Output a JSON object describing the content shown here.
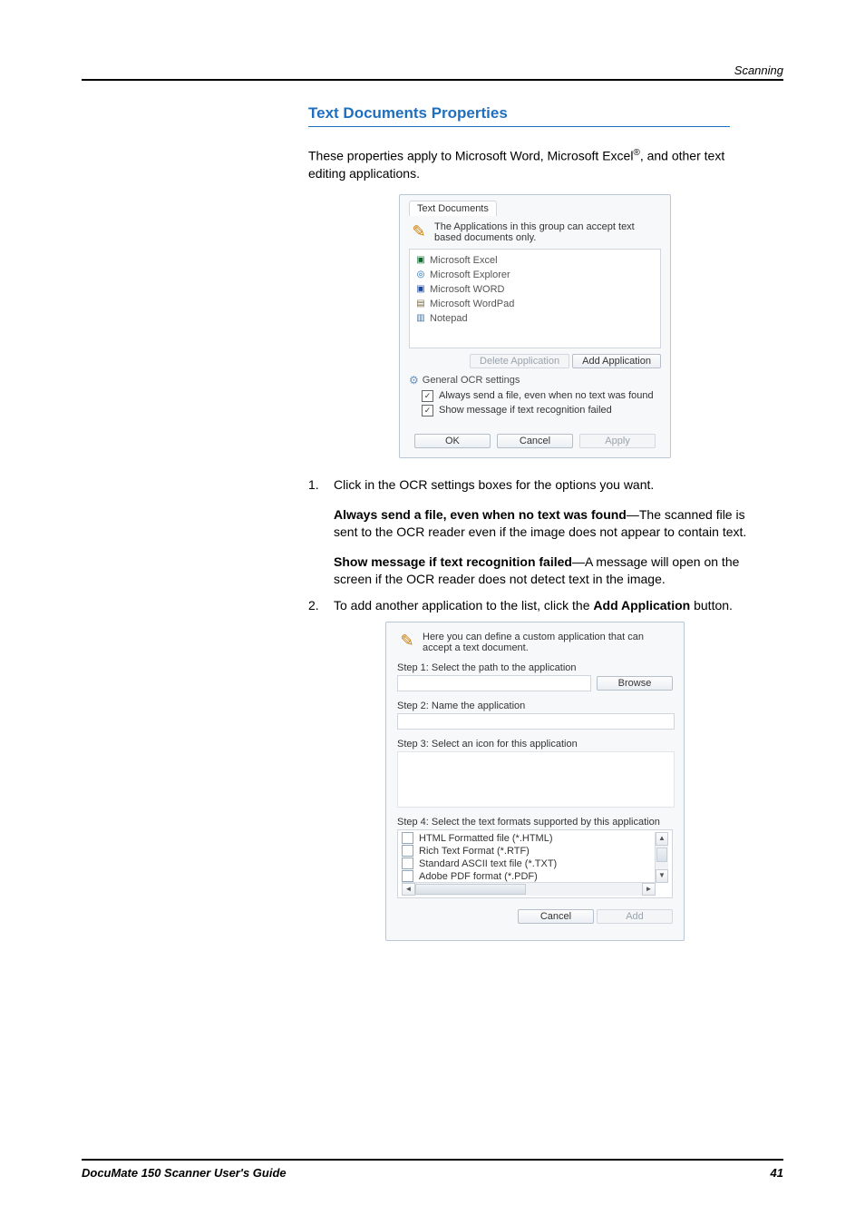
{
  "header": {
    "section": "Scanning"
  },
  "section": {
    "title": "Text Documents Properties",
    "intro_pre": "These properties apply to Microsoft Word, Microsoft Excel",
    "intro_post": ", and other text editing applications."
  },
  "dialog1": {
    "tab": "Text Documents",
    "info": "The Applications in this group can accept text based documents only.",
    "apps": [
      {
        "name": "Microsoft Excel",
        "iconClass": "icon-excel",
        "glyph": "▣"
      },
      {
        "name": "Microsoft Explorer",
        "iconClass": "icon-ie",
        "glyph": "◎"
      },
      {
        "name": "Microsoft WORD",
        "iconClass": "icon-word",
        "glyph": "▣"
      },
      {
        "name": "Microsoft WordPad",
        "iconClass": "icon-wordpad",
        "glyph": "▤"
      },
      {
        "name": "Notepad",
        "iconClass": "icon-notepad",
        "glyph": "▥"
      }
    ],
    "delete_btn": "Delete Application",
    "add_btn": "Add Application",
    "group": "General OCR settings",
    "chk1": "Always send a file, even when no text was found",
    "chk2": "Show message if text recognition failed",
    "ok": "OK",
    "cancel": "Cancel",
    "apply": "Apply"
  },
  "steps": {
    "s1_num": "1.",
    "s1_text": "Click in the OCR settings boxes for the options you want.",
    "opt1_bold": "Always send a file, even when no text was found",
    "opt1_rest": "—The scanned file is sent to the OCR reader even if the image does not appear to contain text.",
    "opt2_bold": "Show message if text recognition failed",
    "opt2_rest": "—A message will open on the screen if the OCR reader does not detect text in the image.",
    "s2_num": "2.",
    "s2_pre": "To add another application to the list, click the ",
    "s2_bold": "Add Application",
    "s2_post": " button."
  },
  "dialog2": {
    "info": "Here you can define a custom application that can accept a text document.",
    "step1": "Step 1: Select the path to the application",
    "browse": "Browse",
    "step2": "Step 2: Name the application",
    "step3": "Step 3: Select an icon for this application",
    "step4": "Step 4: Select the text formats supported by this application",
    "formats": [
      "HTML Formatted file (*.HTML)",
      "Rich Text Format (*.RTF)",
      "Standard ASCII text file (*.TXT)",
      "Adobe PDF format (*.PDF)"
    ],
    "cancel": "Cancel",
    "add": "Add"
  },
  "footer": {
    "left": "DocuMate 150 Scanner User's Guide",
    "right": "41"
  }
}
